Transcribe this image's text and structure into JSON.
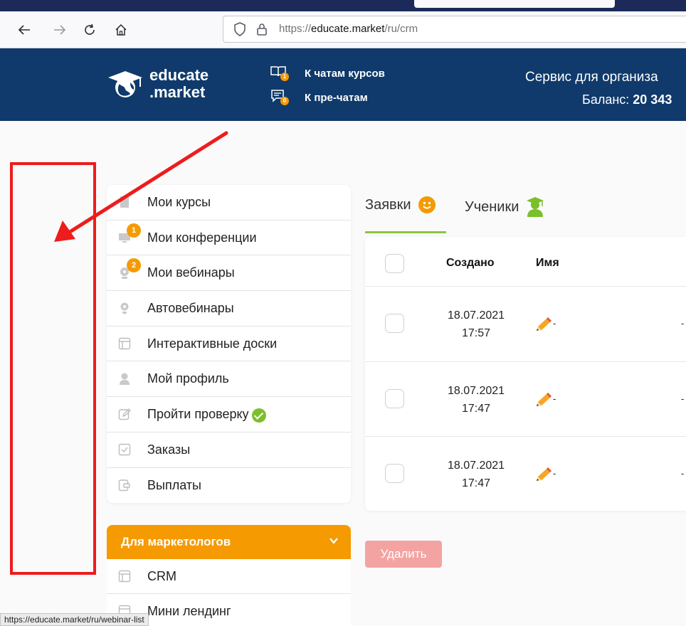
{
  "browser": {
    "url_prefix": "https://",
    "url_domain": "educate.market",
    "url_path": "/ru/crm",
    "status_url": "https://educate.market/ru/webinar-list"
  },
  "header": {
    "logo_line1": "educate",
    "logo_line2": ".market",
    "link_course_chats": "К чатам курсов",
    "link_course_chats_badge": "1",
    "link_prechats": "К пре-чатам",
    "link_prechats_badge": "0",
    "service_text": "Сервис для организа",
    "balance_label": "Баланс: ",
    "balance_value": "20 343"
  },
  "sidebar": {
    "items": [
      {
        "label": "Мои курсы",
        "icon": "book-icon"
      },
      {
        "label": "Мои конференции",
        "icon": "monitor-icon",
        "badge": "1"
      },
      {
        "label": "Мои вебинары",
        "icon": "webcam-icon",
        "badge": "2"
      },
      {
        "label": "Автовебинары",
        "icon": "webcam-icon"
      },
      {
        "label": "Интерактивные доски",
        "icon": "board-icon"
      },
      {
        "label": "Мой профиль",
        "icon": "user-icon"
      },
      {
        "label": "Пройти проверку",
        "icon": "edit-icon"
      },
      {
        "label": "Заказы",
        "icon": "checkbox-icon"
      },
      {
        "label": "Выплаты",
        "icon": "wallet-icon"
      }
    ]
  },
  "marketing": {
    "title": "Для маркетологов",
    "items": [
      "CRM",
      "Мини лендинг"
    ]
  },
  "tabs": {
    "requests": "Заявки",
    "students": "Ученики"
  },
  "table": {
    "col_created": "Создано",
    "col_name": "Имя",
    "rows": [
      {
        "date": "18.07.2021",
        "time": "17:57",
        "name": "-",
        "extra": "-"
      },
      {
        "date": "18.07.2021",
        "time": "17:47",
        "name": "-",
        "extra": "-"
      },
      {
        "date": "18.07.2021",
        "time": "17:47",
        "name": "-",
        "extra": "-"
      }
    ]
  },
  "actions": {
    "delete_label": "Удалить"
  },
  "colors": {
    "header_bg": "#0f3a6b",
    "accent_orange": "#f59a00",
    "accent_green": "#8cc63f",
    "delete_btn": "#f4a3a3",
    "annotation_red": "#ee1c1c"
  }
}
